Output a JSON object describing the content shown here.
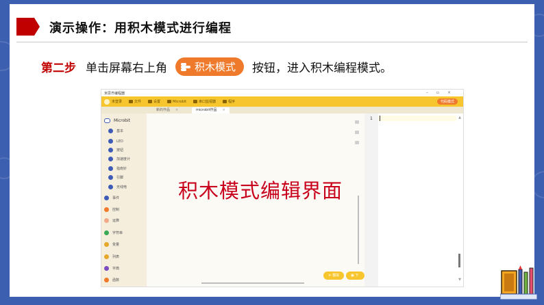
{
  "slide": {
    "title": "演示操作：用积木模式进行编程",
    "step_label": "第二步",
    "step_text_before": "单击屏幕右上角",
    "step_badge": "积木模式",
    "step_text_after": "按钮，进入积木编程模式。"
  },
  "app": {
    "window_title": "米思齐编程器",
    "toolbar": {
      "items": [
        {
          "label": "未登录",
          "icon": "user-icon"
        },
        {
          "label": "文件",
          "icon": "file-icon"
        },
        {
          "label": "设置",
          "icon": "gear-icon"
        },
        {
          "label": "Microbit",
          "icon": "board-icon"
        },
        {
          "label": "串口监视器",
          "icon": "monitor-icon"
        },
        {
          "label": "程序",
          "icon": "program-icon"
        }
      ],
      "mode_button": "代码模式"
    },
    "tabs": [
      {
        "label": "新的作品"
      },
      {
        "label": "microbit作品"
      }
    ],
    "sidebar": {
      "header": "Microbit",
      "items": [
        {
          "label": "基本",
          "color": "#3f5bb5"
        },
        {
          "label": "LED",
          "color": "#3f5bb5"
        },
        {
          "label": "按钮",
          "color": "#3f5bb5"
        },
        {
          "label": "加速度计",
          "color": "#3f5bb5"
        },
        {
          "label": "指南针",
          "color": "#3f5bb5"
        },
        {
          "label": "引脚",
          "color": "#3f5bb5"
        },
        {
          "label": "无线电",
          "color": "#3f5bb5"
        },
        {
          "label": "事件",
          "color": "#3f5bb5"
        },
        {
          "label": "控制",
          "color": "#f07a2b"
        },
        {
          "label": "运算",
          "color": "#f2a98a"
        },
        {
          "label": "字符串",
          "color": "#3caa54"
        },
        {
          "label": "变量",
          "color": "#e5a82b"
        },
        {
          "label": "列表",
          "color": "#e5a82b"
        },
        {
          "label": "字典",
          "color": "#7b4bc0"
        },
        {
          "label": "函数",
          "color": "#f07a2b"
        }
      ]
    },
    "canvas": {
      "overlay_text": "积木模式编辑界面",
      "run_button": "模拟",
      "upload_button": "下载"
    },
    "code": {
      "line_number": "1"
    }
  },
  "colors": {
    "frame": "#3d5fb0",
    "accent": "#c00000",
    "toolbar": "#f7c62f",
    "mode_button": "#f07a2b"
  }
}
